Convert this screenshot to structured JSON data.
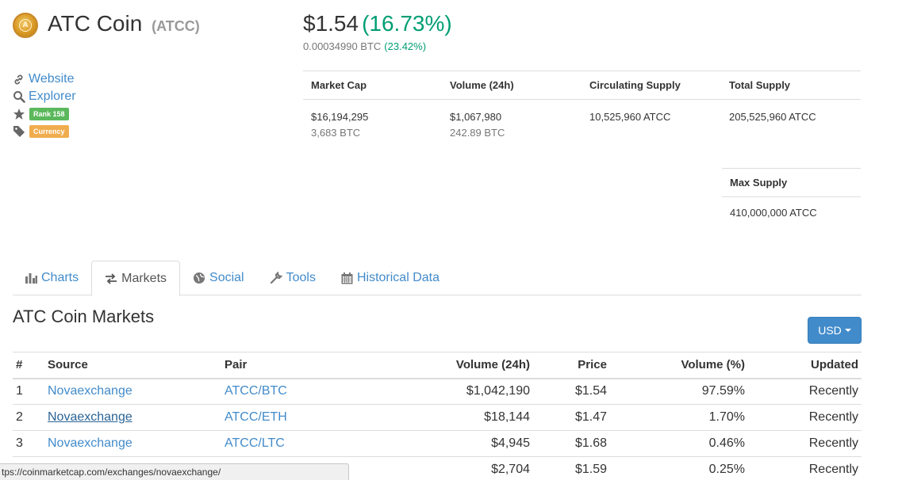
{
  "header": {
    "coin_name": "ATC Coin",
    "coin_symbol": "(ATCC)",
    "price_usd": "$1.54",
    "price_change": "(16.73%)",
    "price_btc": "0.00034990 BTC",
    "price_btc_change": "(23.42%)"
  },
  "sidebar": {
    "website_label": "Website",
    "explorer_label": "Explorer",
    "rank_badge": "Rank 158",
    "category_badge": "Currency"
  },
  "stats": {
    "market_cap": {
      "label": "Market Cap",
      "usd": "$16,194,295",
      "btc": "3,683 BTC"
    },
    "volume": {
      "label": "Volume (24h)",
      "usd": "$1,067,980",
      "btc": "242.89 BTC"
    },
    "circulating": {
      "label": "Circulating Supply",
      "value": "10,525,960 ATCC"
    },
    "total": {
      "label": "Total Supply",
      "value": "205,525,960 ATCC"
    },
    "max": {
      "label": "Max Supply",
      "value": "410,000,000 ATCC"
    }
  },
  "tabs": [
    {
      "label": "Charts",
      "icon": "bar-chart-icon",
      "active": false
    },
    {
      "label": "Markets",
      "icon": "exchange-arrows-icon",
      "active": true
    },
    {
      "label": "Social",
      "icon": "globe-icon",
      "active": false
    },
    {
      "label": "Tools",
      "icon": "wrench-icon",
      "active": false
    },
    {
      "label": "Historical Data",
      "icon": "calendar-icon",
      "active": false
    }
  ],
  "markets": {
    "title": "ATC Coin Markets",
    "currency_button": "USD",
    "columns": [
      "#",
      "Source",
      "Pair",
      "Volume (24h)",
      "Price",
      "Volume (%)",
      "Updated"
    ],
    "rows": [
      {
        "num": "1",
        "source": "Novaexchange",
        "pair": "ATCC/BTC",
        "volume": "$1,042,190",
        "price": "$1.54",
        "volume_pct": "97.59%",
        "updated": "Recently"
      },
      {
        "num": "2",
        "source": "Novaexchange",
        "pair": "ATCC/ETH",
        "volume": "$18,144",
        "price": "$1.47",
        "volume_pct": "1.70%",
        "updated": "Recently"
      },
      {
        "num": "3",
        "source": "Novaexchange",
        "pair": "ATCC/LTC",
        "volume": "$4,945",
        "price": "$1.68",
        "volume_pct": "0.46%",
        "updated": "Recently"
      },
      {
        "num": "",
        "source": "",
        "pair": "",
        "volume": "$2,704",
        "price": "$1.59",
        "volume_pct": "0.25%",
        "updated": "Recently"
      }
    ]
  },
  "statusbar": {
    "url": "tps://coinmarketcap.com/exchanges/novaexchange/"
  },
  "colors": {
    "link": "#428bca",
    "positive": "#009e73",
    "rank_badge": "#5cb85c",
    "category_badge": "#f0ad4e",
    "button": "#428bca"
  }
}
